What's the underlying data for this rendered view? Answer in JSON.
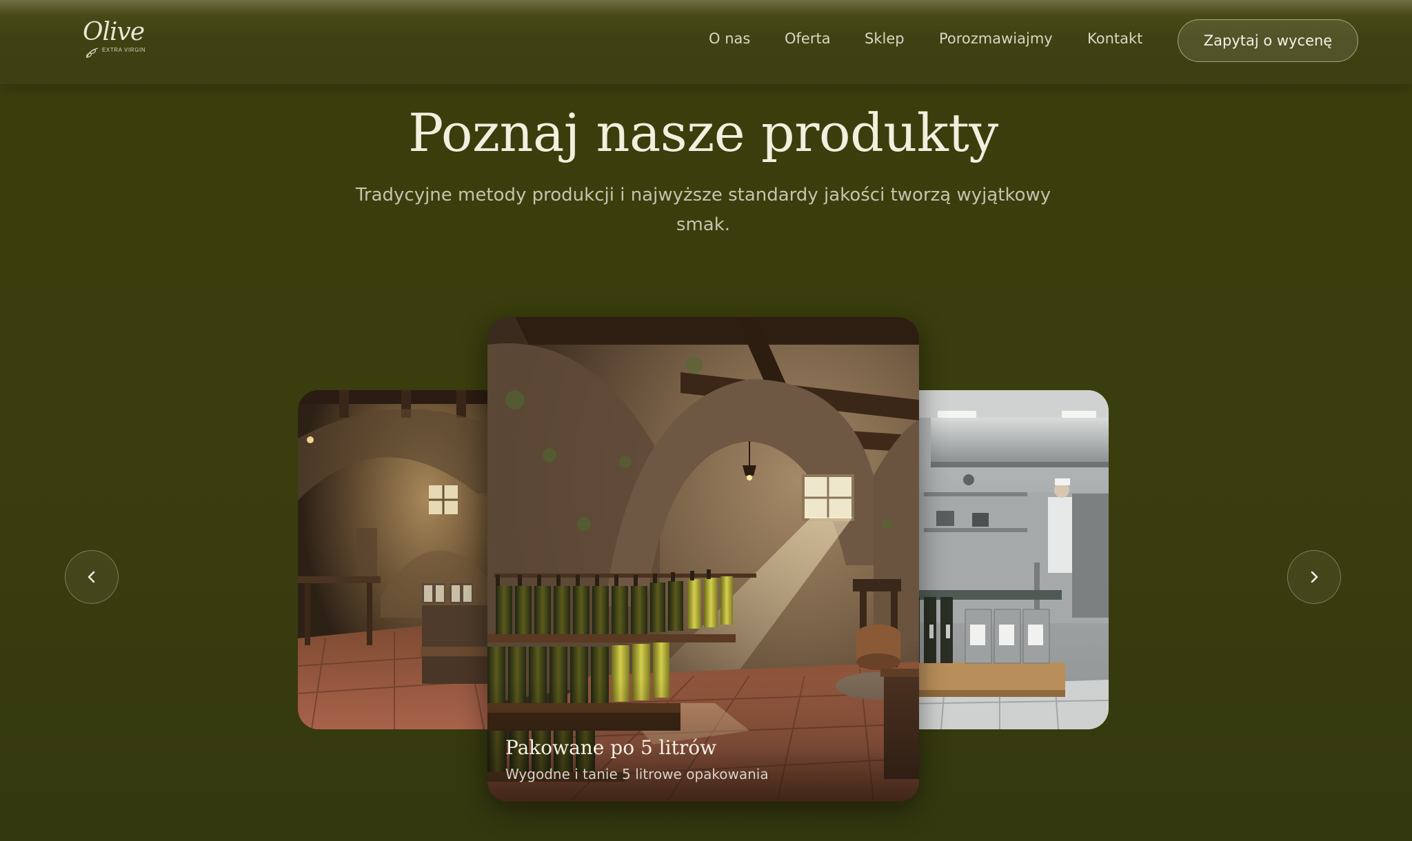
{
  "header": {
    "logo": {
      "word": "Olive",
      "sub": "EXTRA VIRGIN"
    },
    "nav": [
      {
        "label": "O nas"
      },
      {
        "label": "Oferta"
      },
      {
        "label": "Sklep"
      },
      {
        "label": "Porozmawiajmy"
      },
      {
        "label": "Kontakt"
      }
    ],
    "cta_label": "Zapytaj o wycenę"
  },
  "hero": {
    "title": "Poznaj nasze produkty",
    "subtitle": "Tradycyjne metody produkcji i najwyższe standardy jakości tworzą wyjątkowy smak."
  },
  "carousel": {
    "active": {
      "title": "Pakowane po 5 litrów",
      "subtitle": "Wygodne i tanie 5 litrowe opakowania"
    },
    "prev_icon": "chevron-left-icon",
    "next_icon": "chevron-right-icon"
  },
  "colors": {
    "background": "#3a3d0e",
    "header": "#3d4012",
    "text": "#f1efde",
    "muted_text": "#c6c4ad"
  }
}
